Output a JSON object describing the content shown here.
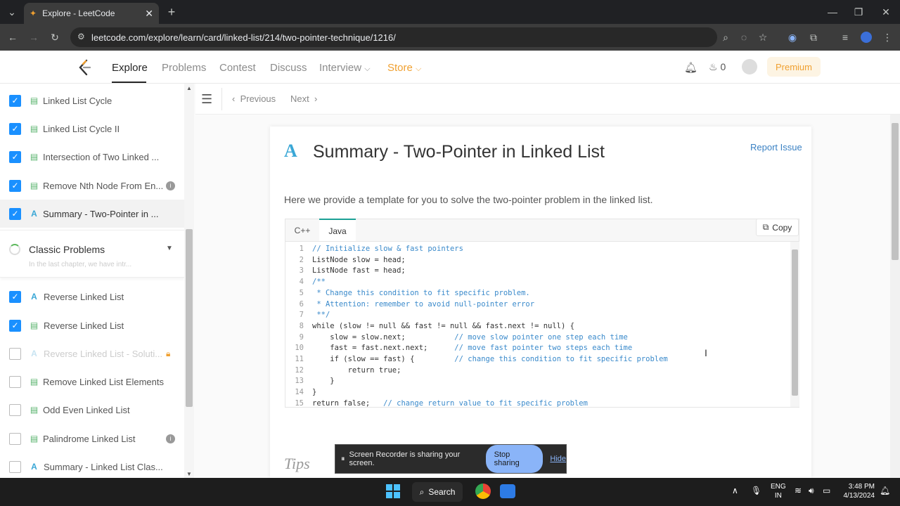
{
  "browser": {
    "tab_title": "Explore - LeetCode",
    "url": "leetcode.com/explore/learn/card/linked-list/214/two-pointer-technique/1216/"
  },
  "nav": {
    "explore": "Explore",
    "problems": "Problems",
    "contest": "Contest",
    "discuss": "Discuss",
    "interview": "Interview",
    "store": "Store",
    "streak_count": "0",
    "premium": "Premium"
  },
  "sidebar": {
    "items": [
      {
        "label": "Linked List Cycle",
        "checked": true,
        "type": "doc"
      },
      {
        "label": "Linked List Cycle II",
        "checked": true,
        "type": "doc"
      },
      {
        "label": "Intersection of Two Linked ...",
        "checked": true,
        "type": "doc"
      },
      {
        "label": "Remove Nth Node From En...",
        "checked": true,
        "type": "doc"
      },
      {
        "label": "Summary - Two-Pointer in ...",
        "checked": true,
        "type": "article"
      }
    ],
    "chapter": {
      "title": "Classic Problems",
      "subtitle": "In the last chapter, we have intr..."
    },
    "items2": [
      {
        "label": "Reverse Linked List",
        "checked": true,
        "type": "article"
      },
      {
        "label": "Reverse Linked List",
        "checked": true,
        "type": "doc"
      },
      {
        "label": "Reverse Linked List - Soluti...",
        "checked": false,
        "type": "article"
      },
      {
        "label": "Remove Linked List Elements",
        "checked": false,
        "type": "doc"
      },
      {
        "label": "Odd Even Linked List",
        "checked": false,
        "type": "doc"
      },
      {
        "label": "Palindrome Linked List",
        "checked": false,
        "type": "doc"
      },
      {
        "label": "Summary - Linked List Clas...",
        "checked": false,
        "type": "article"
      }
    ]
  },
  "toolbar": {
    "previous": "Previous",
    "next": "Next"
  },
  "article": {
    "title": "Summary - Two-Pointer in Linked List",
    "report": "Report Issue",
    "intro": "Here we provide a template for you to solve the two-pointer problem in the linked list.",
    "tabs": [
      "C++",
      "Java"
    ],
    "copy": "Copy",
    "code_lines": [
      "// Initialize slow & fast pointers",
      "ListNode slow = head;",
      "ListNode fast = head;",
      "/**",
      " * Change this condition to fit specific problem.",
      " * Attention: remember to avoid null-pointer error",
      " **/",
      "while (slow != null && fast != null && fast.next != null) {",
      "    slow = slow.next;           // move slow pointer one step each time",
      "    fast = fast.next.next;      // move fast pointer two steps each time",
      "    if (slow == fast) {         // change this condition to fit specific problem",
      "        return true;",
      "    }",
      "}",
      "return false;   // change return value to fit specific problem"
    ],
    "tips": "Tips"
  },
  "share_bar": {
    "text": "Screen Recorder is sharing your screen.",
    "stop": "Stop sharing",
    "hide": "Hide"
  },
  "taskbar": {
    "search": "Search",
    "lang1": "ENG",
    "lang2": "IN",
    "time": "3:48 PM",
    "date": "4/13/2024"
  }
}
